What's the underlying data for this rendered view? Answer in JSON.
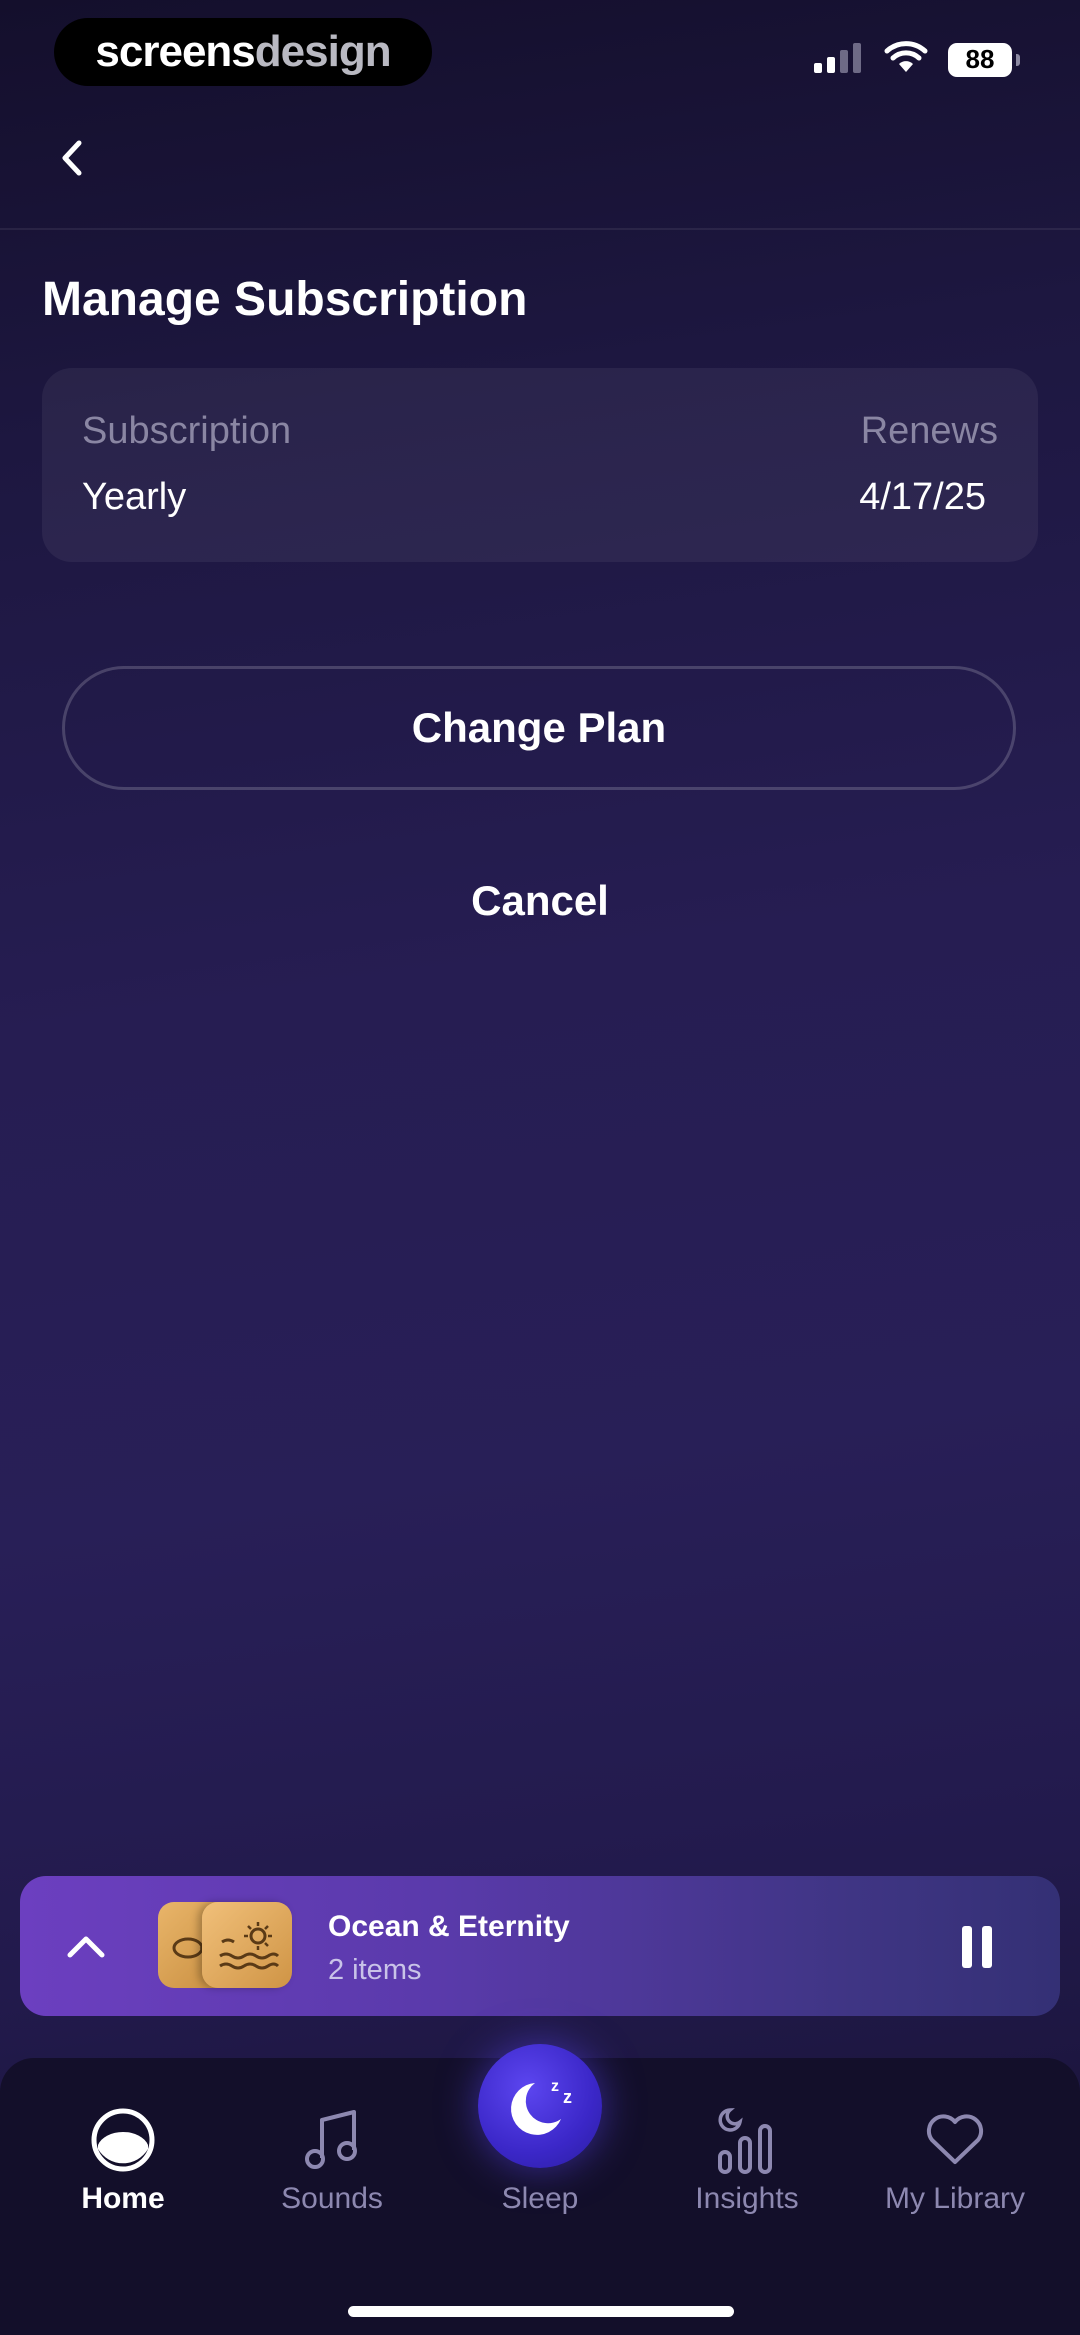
{
  "status_bar": {
    "brand_part1": "screens",
    "brand_part2": "design",
    "battery": "88"
  },
  "header": {
    "title": "Manage Subscription"
  },
  "subscription": {
    "label": "Subscription",
    "value": "Yearly",
    "renews_label": "Renews",
    "renews_value": "4/17/25"
  },
  "actions": {
    "change_plan": "Change Plan",
    "cancel": "Cancel"
  },
  "player": {
    "title": "Ocean & Eternity",
    "subtitle": "2 items"
  },
  "tabs": [
    {
      "label": "Home",
      "icon": "home-icon",
      "active": true
    },
    {
      "label": "Sounds",
      "icon": "music-note-icon",
      "active": false
    },
    {
      "label": "Sleep",
      "icon": "moon-icon",
      "active": false
    },
    {
      "label": "Insights",
      "icon": "chart-icon",
      "active": false
    },
    {
      "label": "My Library",
      "icon": "heart-icon",
      "active": false
    }
  ],
  "colors": {
    "accent": "#3b27c8",
    "player_start": "#6c3fc0",
    "background": "#261d52"
  }
}
